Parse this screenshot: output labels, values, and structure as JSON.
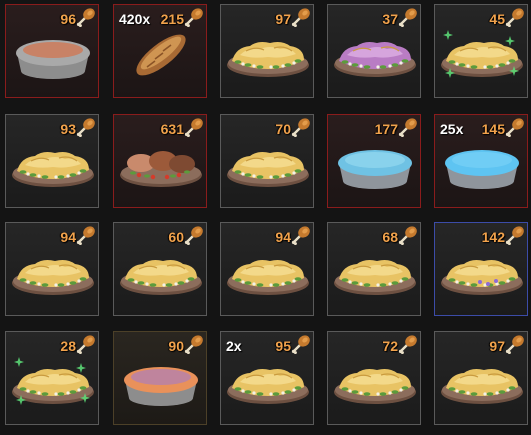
{
  "inventory": {
    "slots": [
      {
        "count": "96",
        "stack": "",
        "item": "grey-pie",
        "frame": "red"
      },
      {
        "count": "215",
        "stack": "420x",
        "item": "bread-loaf",
        "frame": "red"
      },
      {
        "count": "97",
        "stack": "",
        "item": "yellow-salad",
        "frame": "grey"
      },
      {
        "count": "37",
        "stack": "",
        "item": "purple-salad",
        "frame": "grey"
      },
      {
        "count": "45",
        "stack": "",
        "item": "yellow-salad-sparkle",
        "frame": "grey"
      },
      {
        "count": "93",
        "stack": "",
        "item": "yellow-salad",
        "frame": "grey"
      },
      {
        "count": "631",
        "stack": "",
        "item": "meat-platter",
        "frame": "red"
      },
      {
        "count": "70",
        "stack": "",
        "item": "yellow-salad",
        "frame": "grey"
      },
      {
        "count": "177",
        "stack": "",
        "item": "blue-pie",
        "frame": "red"
      },
      {
        "count": "145",
        "stack": "25x",
        "item": "blue-pie-plain",
        "frame": "red"
      },
      {
        "count": "94",
        "stack": "",
        "item": "yellow-salad",
        "frame": "grey"
      },
      {
        "count": "60",
        "stack": "",
        "item": "yellow-salad",
        "frame": "grey"
      },
      {
        "count": "94",
        "stack": "",
        "item": "yellow-salad",
        "frame": "grey"
      },
      {
        "count": "68",
        "stack": "",
        "item": "yellow-salad",
        "frame": "grey"
      },
      {
        "count": "142",
        "stack": "",
        "item": "yellow-salad-purple",
        "frame": "blue"
      },
      {
        "count": "28",
        "stack": "",
        "item": "yellow-salad-sparkle",
        "frame": "grey"
      },
      {
        "count": "90",
        "stack": "",
        "item": "orange-pie",
        "frame": "gold"
      },
      {
        "count": "95",
        "stack": "2x",
        "item": "yellow-salad",
        "frame": "grey"
      },
      {
        "count": "72",
        "stack": "",
        "item": "yellow-salad",
        "frame": "grey"
      },
      {
        "count": "97",
        "stack": "",
        "item": "yellow-salad",
        "frame": "grey"
      }
    ]
  },
  "colors": {
    "count_text": "#f1a24c",
    "frame_grey": "#5a5a5a",
    "frame_red": "#8a1c1c",
    "frame_blue": "#3c4ca8",
    "frame_gold": "#4c4028"
  }
}
